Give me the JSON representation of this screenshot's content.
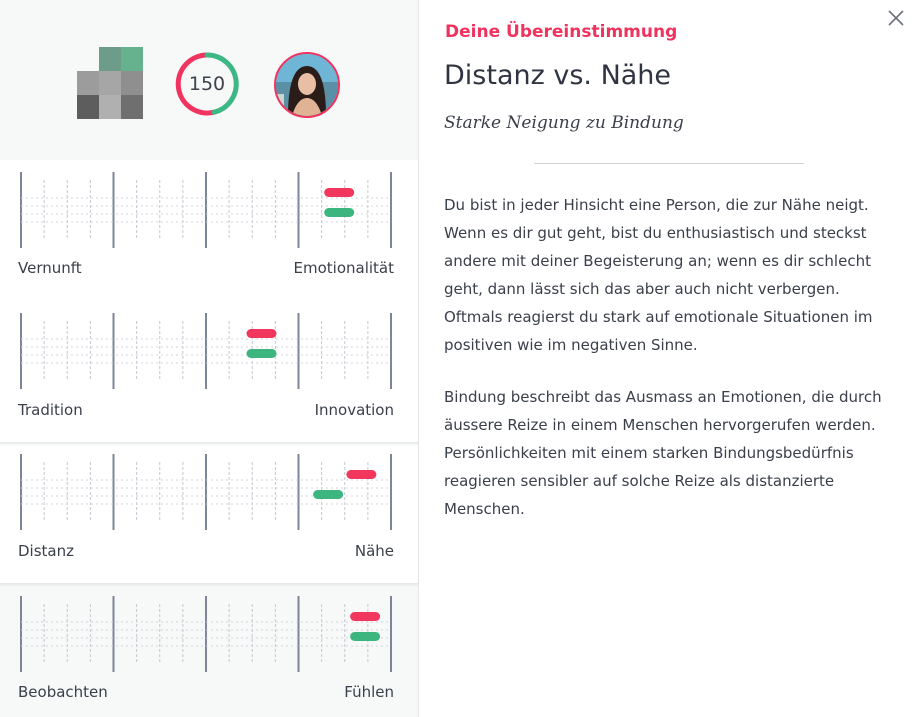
{
  "header": {
    "kicker": "Deine Übereinstimmung",
    "title": "Distanz vs. Nähe",
    "subtitle": "Starke Neigung zu Bindung"
  },
  "close_icon": "close-icon",
  "profile": {
    "score": "150",
    "score_colors": [
      "#f0345f",
      "#3db884"
    ],
    "my_avatar": "blurred-avatar",
    "match_avatar": "profile-photo"
  },
  "colors": {
    "accent": "#ef335e",
    "marker_red": "#f2375f",
    "marker_green": "#3cb57f"
  },
  "dimensions": [
    {
      "left": "Vernunft",
      "right": "Emotionalität",
      "red": 0.86,
      "green": 0.86
    },
    {
      "left": "Tradition",
      "right": "Innovation",
      "red": 0.65,
      "green": 0.65
    },
    {
      "left": "Distanz",
      "right": "Nähe",
      "red": 0.92,
      "green": 0.83
    },
    {
      "left": "Beobachten",
      "right": "Fühlen",
      "red": 0.93,
      "green": 0.93
    }
  ],
  "body": {
    "p1": "Du bist in jeder Hinsicht eine Person, die zur Nähe neigt. Wenn es dir gut geht, bist du enthusiastisch und steckst andere mit deiner Begeisterung an; wenn es dir schlecht geht, dann lässt sich das aber auch nicht verbergen. Oftmals reagierst du stark auf emotionale Situationen im positiven wie im negativen Sinne.",
    "p2": "Bindung beschreibt das Ausmass an Emotionen, die durch äussere Reize in einem Menschen hervorgerufen werden. Persönlichkeiten mit einem starken Bindungsbedürfnis reagieren sensibler auf solche Reize als distanzierte Menschen."
  }
}
